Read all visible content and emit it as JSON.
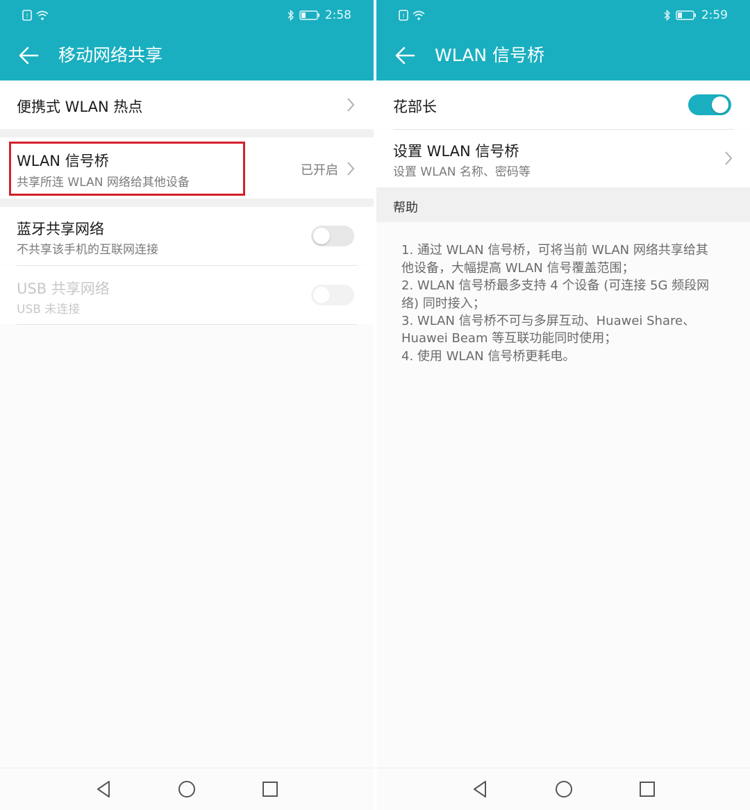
{
  "left": {
    "status": {
      "time": "2:58"
    },
    "title": "移动网络共享",
    "items": [
      {
        "label": "便携式 WLAN 热点"
      },
      {
        "label": "WLAN 信号桥",
        "sub": "共享所连 WLAN 网络给其他设备",
        "value": "已开启"
      },
      {
        "label": "蓝牙共享网络",
        "sub": "不共享该手机的互联网连接",
        "toggle": "off"
      },
      {
        "label": "USB 共享网络",
        "sub": "USB 未连接",
        "toggle": "disabled"
      }
    ]
  },
  "right": {
    "status": {
      "time": "2:59"
    },
    "title": "WLAN 信号桥",
    "items": [
      {
        "label": "花部长",
        "toggle": "on"
      },
      {
        "label": "设置 WLAN 信号桥",
        "sub": "设置 WLAN 名称、密码等"
      }
    ],
    "help_header": "帮助",
    "help_lines": [
      "1. 通过 WLAN 信号桥，可将当前 WLAN 网络共享给其",
      "他设备，大幅提高 WLAN 信号覆盖范围；",
      "2. WLAN 信号桥最多支持 4 个设备 (可连接 5G 频段网",
      "络) 同时接入；",
      "3. WLAN 信号桥不可与多屏互动、Huawei Share、",
      "Huawei Beam 等互联功能同时使用；",
      "4. 使用 WLAN 信号桥更耗电。"
    ]
  },
  "colors": {
    "accent": "#19afc0",
    "highlight": "#d4202b"
  },
  "icons": [
    "sim-icon",
    "wifi-icon",
    "bluetooth-icon",
    "battery-icon",
    "back-arrow-icon",
    "chevron-right-icon",
    "nav-back-icon",
    "nav-home-icon",
    "nav-recents-icon"
  ]
}
